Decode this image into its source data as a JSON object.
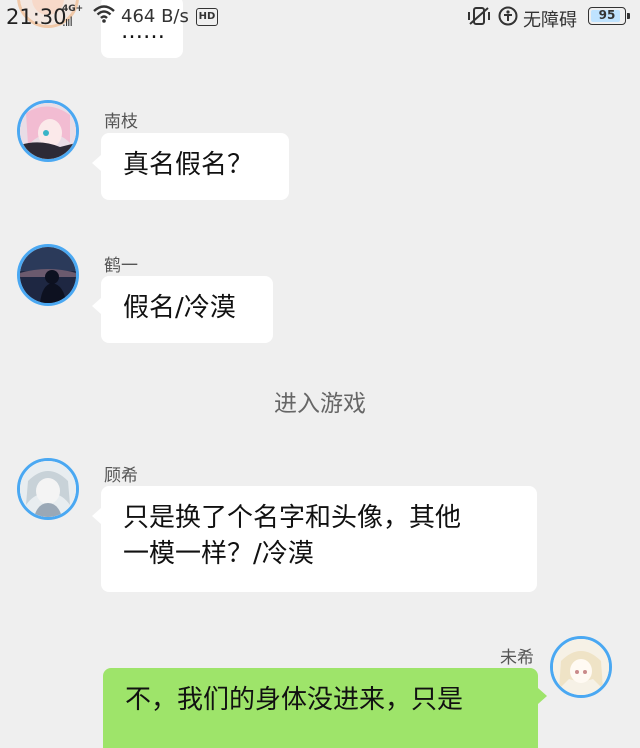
{
  "status_bar": {
    "time": "21:30",
    "network": "4G+",
    "signal": ".ııl",
    "speed": "464 B/s",
    "hd": "HD",
    "accessibility_label": "无障碍",
    "battery": "95",
    "battery_level": 0.95
  },
  "messages": [
    {
      "type": "bubble",
      "side": "left",
      "name": "",
      "text": "……"
    },
    {
      "type": "bubble",
      "side": "left",
      "name": "南枝",
      "text": "真名假名？"
    },
    {
      "type": "bubble",
      "side": "left",
      "name": "鹤一",
      "text": "假名/冷漠"
    },
    {
      "type": "system",
      "text": "进入游戏"
    },
    {
      "type": "bubble",
      "side": "left",
      "name": "顾希",
      "text_lines": [
        "只是换了个名字和头像，其他",
        "一模一样？/冷漠"
      ]
    },
    {
      "type": "bubble",
      "side": "right",
      "name": "未希",
      "text": "不，我们的身体没进来，只是"
    }
  ],
  "colors": {
    "background": "#efefef",
    "avatar_ring": "#4aa8f2",
    "self_bubble": "#9ee46a",
    "other_bubble": "#ffffff"
  }
}
